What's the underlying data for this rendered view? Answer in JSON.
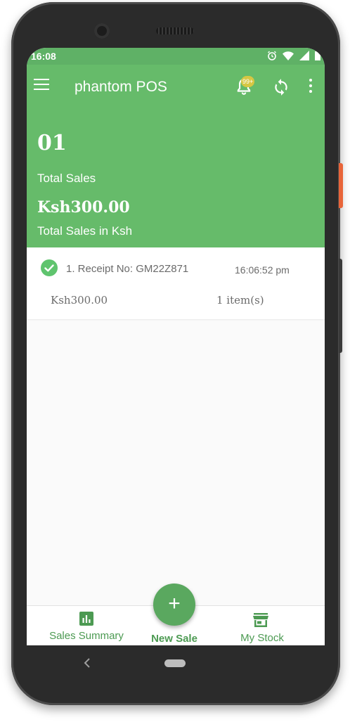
{
  "status_bar": {
    "time": "16:08",
    "icons": [
      "alarm-icon",
      "wifi-icon",
      "signal-icon",
      "battery-icon"
    ]
  },
  "app_bar": {
    "title": "phantom POS",
    "notification_badge": "99+",
    "icons": [
      "menu-icon",
      "bell-icon",
      "sync-icon",
      "more-vert-icon"
    ]
  },
  "summary": {
    "total_sales_count": "01",
    "total_sales_label": "Total Sales",
    "total_amount": "Ksh300.00",
    "total_amount_label": "Total Sales in Ksh"
  },
  "receipts": [
    {
      "title": "1. Receipt No: GM22Z871",
      "time": "16:06:52 pm",
      "amount": "Ksh300.00",
      "items": "1 item(s)",
      "status_icon": "check-circle-icon"
    }
  ],
  "bottom_nav": {
    "sales_summary": "Sales Summary",
    "new_sale": "New Sale",
    "my_stock": "My Stock",
    "fab_symbol": "+"
  },
  "colors": {
    "primary": "#66bb6a",
    "accent": "#5aa85f",
    "badge": "#d6c743",
    "text_muted": "#6b6b6b"
  }
}
